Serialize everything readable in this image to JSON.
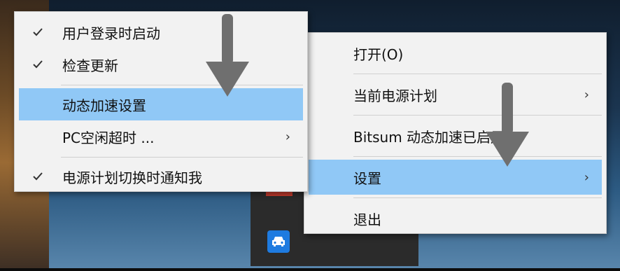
{
  "colors": {
    "highlight": "#90c8f6",
    "menu_bg": "#f2f2f2",
    "arrow": "#6f6f6f"
  },
  "context_menu": {
    "items": [
      {
        "label": "打开(O)"
      },
      {
        "label": "当前电源计划",
        "submenu": "›"
      },
      {
        "label": "Bitsum 动态加速已启用"
      },
      {
        "label": "设置",
        "submenu": "›"
      },
      {
        "label": "退出"
      }
    ]
  },
  "settings_submenu": {
    "items": [
      {
        "label": "用户登录时启动",
        "checked": true
      },
      {
        "label": "检查更新",
        "checked": true
      },
      {
        "label": "动态加速设置"
      },
      {
        "label": "PC空闲超时 ...",
        "submenu": "›"
      },
      {
        "label": "电源计划切换时通知我",
        "checked": true
      }
    ]
  },
  "tray": {
    "icon": "car-icon"
  }
}
